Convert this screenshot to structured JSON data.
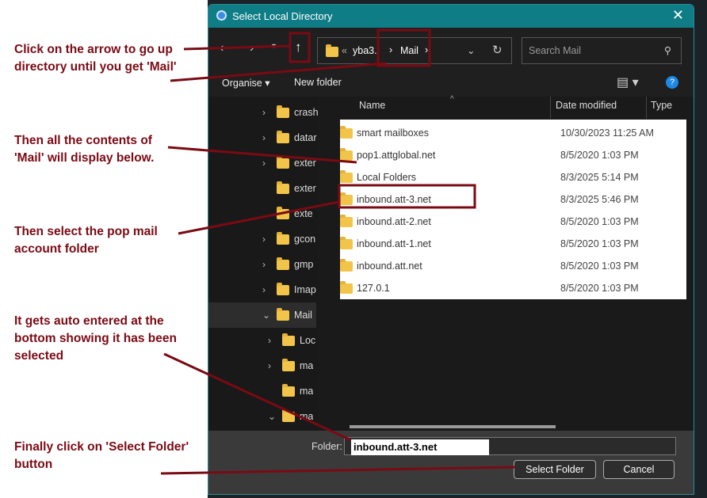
{
  "annotations": [
    "Click on the arrow to go up directory until you get 'Mail'",
    "Then all the contents of 'Mail' will display below.",
    "Then select the pop mail account folder",
    "It gets auto entered at the bottom showing it has been selected",
    "Finally click on 'Select Folder' button"
  ],
  "dialog": {
    "title": "Select Local Directory",
    "breadcrumb": {
      "overflow": "«",
      "parent": "yba3..",
      "current": "Mail"
    },
    "search_placeholder": "Search Mail",
    "organise": "Organise ▾",
    "new_folder": "New folder",
    "nav": [
      "crash",
      "datar",
      "exter",
      "exter",
      "exte",
      "gcon",
      "gmp",
      "Imap",
      "Mail",
      "Loc",
      "ma",
      "ma",
      "ma"
    ],
    "columns": {
      "name": "Name",
      "date": "Date modified",
      "type": "Type"
    },
    "files": [
      {
        "name": "smart mailboxes",
        "date": "10/30/2023 11:25 AM"
      },
      {
        "name": "pop1.attglobal.net",
        "date": "8/5/2020 1:03 PM"
      },
      {
        "name": "Local Folders",
        "date": "8/3/2025 5:14 PM"
      },
      {
        "name": "inbound.att-3.net",
        "date": "8/3/2025 5:46 PM"
      },
      {
        "name": "inbound.att-2.net",
        "date": "8/5/2020 1:03 PM"
      },
      {
        "name": "inbound.att-1.net",
        "date": "8/5/2020 1:03 PM"
      },
      {
        "name": "inbound.att.net",
        "date": "8/5/2020 1:03 PM"
      },
      {
        "name": "127.0.1",
        "date": "8/5/2020 1:03 PM"
      }
    ],
    "folder_label": "Folder:",
    "folder_value": "inbound.att-3.net",
    "select_button": "Select Folder",
    "cancel_button": "Cancel"
  },
  "colors": {
    "annotation": "#7a0a14",
    "titlebar": "#0f7d86"
  }
}
